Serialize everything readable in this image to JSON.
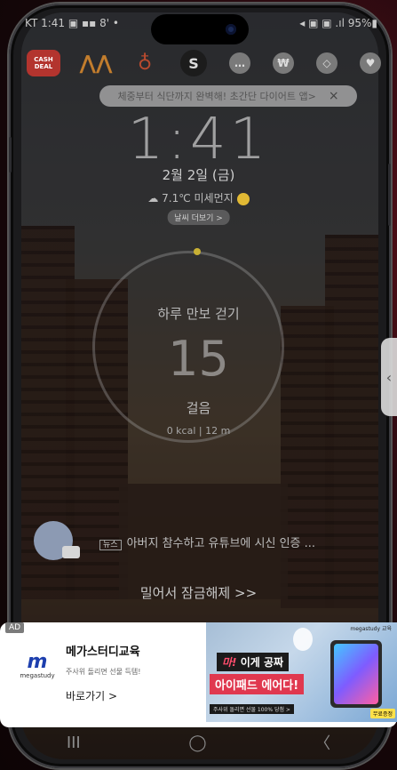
{
  "status_bar": {
    "left": "KT 1:41 ▣ ▪▪ 8' •",
    "right": "◂ ▣ ▣ .ıl 95%▮"
  },
  "apps": [
    {
      "name": "cashdeal-app",
      "label": "CASH DEAL"
    },
    {
      "name": "arrows-app",
      "label": "⋀⋀"
    },
    {
      "name": "badge-app",
      "label": "♁"
    },
    {
      "name": "s-app",
      "label": "S"
    },
    {
      "name": "chat-app",
      "label": "…"
    },
    {
      "name": "coin-app",
      "label": "₩"
    },
    {
      "name": "pill-app",
      "label": "◇"
    },
    {
      "name": "heart-app",
      "label": "♥"
    }
  ],
  "banner": {
    "text": "체중부터 식단까지 완벽해! 초간단 다이어트 앱>",
    "close_icon": "×"
  },
  "lock": {
    "time": "1:41",
    "date": "2월 2일 (금)",
    "weather": "☁ 7.1℃ 미세먼지",
    "weather_button": "날씨 더보기 >"
  },
  "walk": {
    "title": "하루 만보 걷기",
    "steps": "15",
    "unit": "걸음",
    "sub": "0 kcal  |  12 m"
  },
  "news": {
    "tag": "뉴스",
    "text": "아버지 참수하고 유튜브에 시신 인증 ..."
  },
  "unlock_text": "밀어서 잠금해제 >>",
  "handle_icon": "‹",
  "ad": {
    "badge": "AD",
    "logo": "m",
    "logo_text": "megastudy",
    "title": "메가스터디교육",
    "desc": "주사위 돌리면 선물 득템!",
    "link": "바로가기 >",
    "img_brand": "megastudy 교육",
    "img_line1_a": "마!",
    "img_line1_b": " 이게 공짜",
    "img_line2": "아이패드 에어다!",
    "img_line3": "주사위 돌리면 선물 100% 당첨 >",
    "img_sticker": "무료증정"
  },
  "nav": {
    "recents": "III",
    "home": "◯",
    "back": "〈"
  }
}
